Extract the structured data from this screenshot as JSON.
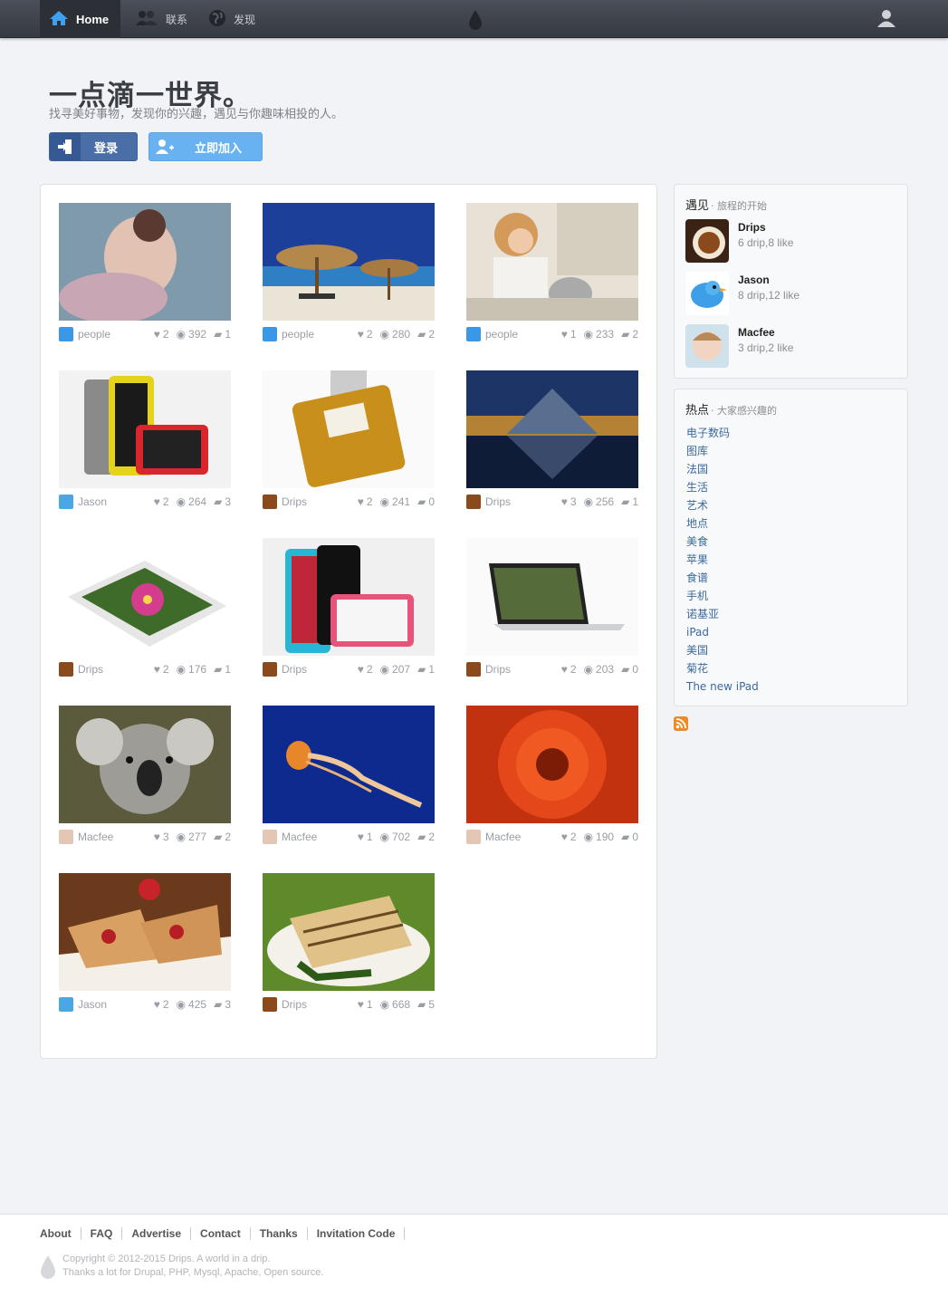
{
  "nav": {
    "home_label": "Home",
    "contact_label": "联系",
    "discover_label": "发现"
  },
  "hero": {
    "title": "一点滴一世界。",
    "subtitle": "找寻美好事物，发现你的兴趣，遇见与你趣味相投的人。",
    "login_label": "登录",
    "join_label": "立即加入"
  },
  "tiles": [
    {
      "author": "people",
      "likes": "2",
      "views": "392",
      "comments": "1"
    },
    {
      "author": "people",
      "likes": "2",
      "views": "280",
      "comments": "2"
    },
    {
      "author": "people",
      "likes": "1",
      "views": "233",
      "comments": "2"
    },
    {
      "author": "Jason",
      "likes": "2",
      "views": "264",
      "comments": "3"
    },
    {
      "author": "Drips",
      "likes": "2",
      "views": "241",
      "comments": "0"
    },
    {
      "author": "Drips",
      "likes": "3",
      "views": "256",
      "comments": "1"
    },
    {
      "author": "Drips",
      "likes": "2",
      "views": "176",
      "comments": "1"
    },
    {
      "author": "Drips",
      "likes": "2",
      "views": "207",
      "comments": "1"
    },
    {
      "author": "Drips",
      "likes": "2",
      "views": "203",
      "comments": "0"
    },
    {
      "author": "Macfee",
      "likes": "3",
      "views": "277",
      "comments": "2"
    },
    {
      "author": "Macfee",
      "likes": "1",
      "views": "702",
      "comments": "2"
    },
    {
      "author": "Macfee",
      "likes": "2",
      "views": "190",
      "comments": "0"
    },
    {
      "author": "Jason",
      "likes": "2",
      "views": "425",
      "comments": "3"
    },
    {
      "author": "Drips",
      "likes": "1",
      "views": "668",
      "comments": "5"
    }
  ],
  "sidebar": {
    "meet_title": "遇见",
    "meet_sub": "· 旅程的开始",
    "people": [
      {
        "name": "Drips",
        "stat": "6 drip,8 like"
      },
      {
        "name": "Jason",
        "stat": "8 drip,12 like"
      },
      {
        "name": "Macfee",
        "stat": "3 drip,2 like"
      }
    ],
    "hot_title": "热点",
    "hot_sub": "· 大家感兴趣的",
    "hot_tags": [
      "电子数码",
      "图库",
      "法国",
      "生活",
      "艺术",
      "地点",
      "美食",
      "苹果",
      "食谱",
      "手机",
      "诺基亚",
      "iPad",
      "美国",
      "菊花",
      "The new iPad"
    ]
  },
  "footer": {
    "links": [
      "About",
      "FAQ",
      "Advertise",
      "Contact",
      "Thanks",
      "Invitation Code"
    ],
    "copyright": "Copyright © 2012-2015 Drips. A world in a drip.",
    "thanks": "Thanks a lot for Drupal, PHP, Mysql, Apache, Open source."
  },
  "colors": {
    "topbar": "#3f434b",
    "login_button": "#4a6fa8",
    "join_button": "#69b2f2",
    "link": "#3b6a9e"
  }
}
